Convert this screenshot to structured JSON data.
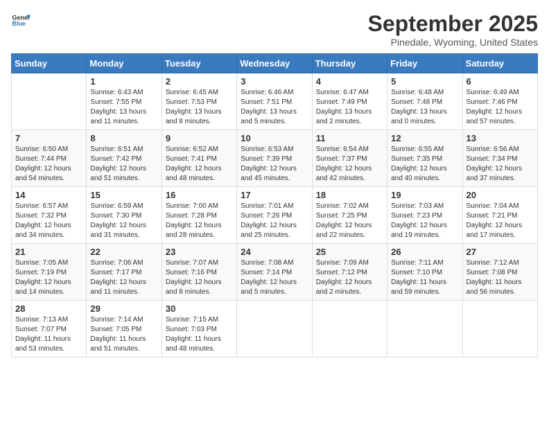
{
  "header": {
    "logo_general": "General",
    "logo_blue": "Blue",
    "month_title": "September 2025",
    "location": "Pinedale, Wyoming, United States"
  },
  "days_of_week": [
    "Sunday",
    "Monday",
    "Tuesday",
    "Wednesday",
    "Thursday",
    "Friday",
    "Saturday"
  ],
  "weeks": [
    [
      {
        "day": "",
        "info": ""
      },
      {
        "day": "1",
        "info": "Sunrise: 6:43 AM\nSunset: 7:55 PM\nDaylight: 13 hours\nand 11 minutes."
      },
      {
        "day": "2",
        "info": "Sunrise: 6:45 AM\nSunset: 7:53 PM\nDaylight: 13 hours\nand 8 minutes."
      },
      {
        "day": "3",
        "info": "Sunrise: 6:46 AM\nSunset: 7:51 PM\nDaylight: 13 hours\nand 5 minutes."
      },
      {
        "day": "4",
        "info": "Sunrise: 6:47 AM\nSunset: 7:49 PM\nDaylight: 13 hours\nand 2 minutes."
      },
      {
        "day": "5",
        "info": "Sunrise: 6:48 AM\nSunset: 7:48 PM\nDaylight: 13 hours\nand 0 minutes."
      },
      {
        "day": "6",
        "info": "Sunrise: 6:49 AM\nSunset: 7:46 PM\nDaylight: 12 hours\nand 57 minutes."
      }
    ],
    [
      {
        "day": "7",
        "info": "Sunrise: 6:50 AM\nSunset: 7:44 PM\nDaylight: 12 hours\nand 54 minutes."
      },
      {
        "day": "8",
        "info": "Sunrise: 6:51 AM\nSunset: 7:42 PM\nDaylight: 12 hours\nand 51 minutes."
      },
      {
        "day": "9",
        "info": "Sunrise: 6:52 AM\nSunset: 7:41 PM\nDaylight: 12 hours\nand 48 minutes."
      },
      {
        "day": "10",
        "info": "Sunrise: 6:53 AM\nSunset: 7:39 PM\nDaylight: 12 hours\nand 45 minutes."
      },
      {
        "day": "11",
        "info": "Sunrise: 6:54 AM\nSunset: 7:37 PM\nDaylight: 12 hours\nand 42 minutes."
      },
      {
        "day": "12",
        "info": "Sunrise: 6:55 AM\nSunset: 7:35 PM\nDaylight: 12 hours\nand 40 minutes."
      },
      {
        "day": "13",
        "info": "Sunrise: 6:56 AM\nSunset: 7:34 PM\nDaylight: 12 hours\nand 37 minutes."
      }
    ],
    [
      {
        "day": "14",
        "info": "Sunrise: 6:57 AM\nSunset: 7:32 PM\nDaylight: 12 hours\nand 34 minutes."
      },
      {
        "day": "15",
        "info": "Sunrise: 6:59 AM\nSunset: 7:30 PM\nDaylight: 12 hours\nand 31 minutes."
      },
      {
        "day": "16",
        "info": "Sunrise: 7:00 AM\nSunset: 7:28 PM\nDaylight: 12 hours\nand 28 minutes."
      },
      {
        "day": "17",
        "info": "Sunrise: 7:01 AM\nSunset: 7:26 PM\nDaylight: 12 hours\nand 25 minutes."
      },
      {
        "day": "18",
        "info": "Sunrise: 7:02 AM\nSunset: 7:25 PM\nDaylight: 12 hours\nand 22 minutes."
      },
      {
        "day": "19",
        "info": "Sunrise: 7:03 AM\nSunset: 7:23 PM\nDaylight: 12 hours\nand 19 minutes."
      },
      {
        "day": "20",
        "info": "Sunrise: 7:04 AM\nSunset: 7:21 PM\nDaylight: 12 hours\nand 17 minutes."
      }
    ],
    [
      {
        "day": "21",
        "info": "Sunrise: 7:05 AM\nSunset: 7:19 PM\nDaylight: 12 hours\nand 14 minutes."
      },
      {
        "day": "22",
        "info": "Sunrise: 7:06 AM\nSunset: 7:17 PM\nDaylight: 12 hours\nand 11 minutes."
      },
      {
        "day": "23",
        "info": "Sunrise: 7:07 AM\nSunset: 7:16 PM\nDaylight: 12 hours\nand 8 minutes."
      },
      {
        "day": "24",
        "info": "Sunrise: 7:08 AM\nSunset: 7:14 PM\nDaylight: 12 hours\nand 5 minutes."
      },
      {
        "day": "25",
        "info": "Sunrise: 7:09 AM\nSunset: 7:12 PM\nDaylight: 12 hours\nand 2 minutes."
      },
      {
        "day": "26",
        "info": "Sunrise: 7:11 AM\nSunset: 7:10 PM\nDaylight: 11 hours\nand 59 minutes."
      },
      {
        "day": "27",
        "info": "Sunrise: 7:12 AM\nSunset: 7:08 PM\nDaylight: 11 hours\nand 56 minutes."
      }
    ],
    [
      {
        "day": "28",
        "info": "Sunrise: 7:13 AM\nSunset: 7:07 PM\nDaylight: 11 hours\nand 53 minutes."
      },
      {
        "day": "29",
        "info": "Sunrise: 7:14 AM\nSunset: 7:05 PM\nDaylight: 11 hours\nand 51 minutes."
      },
      {
        "day": "30",
        "info": "Sunrise: 7:15 AM\nSunset: 7:03 PM\nDaylight: 11 hours\nand 48 minutes."
      },
      {
        "day": "",
        "info": ""
      },
      {
        "day": "",
        "info": ""
      },
      {
        "day": "",
        "info": ""
      },
      {
        "day": "",
        "info": ""
      }
    ]
  ]
}
